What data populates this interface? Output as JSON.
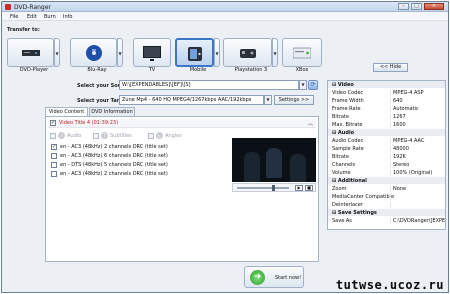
{
  "window": {
    "title": "DVD-Ranger"
  },
  "menu": [
    "File",
    "Edit",
    "Burn",
    "Info"
  ],
  "transfer_label": "Transfer to:",
  "targets": [
    {
      "label": "DVD-Player",
      "icon": "dvd-player-icon",
      "selected": false
    },
    {
      "label": "Blu-Ray",
      "icon": "bluray-disc-icon",
      "selected": false
    },
    {
      "label": "TV",
      "icon": "tv-icon",
      "selected": false
    },
    {
      "label": "Mobile",
      "icon": "mobile-phone-icon",
      "selected": true
    },
    {
      "label": "Playstation 3",
      "icon": "playstation-icon",
      "selected": false
    },
    {
      "label": "XBox",
      "icon": "xbox-icon",
      "selected": false
    }
  ],
  "hide_button": "<< Hide",
  "source": {
    "label": "Select your Source:",
    "value": "W:\\[EXPENDABLES]\\[EF]\\[S]"
  },
  "target": {
    "label": "Select your Target:",
    "value": "Zune Mp4 - 640 HQ MPEG4/1267kbps AAC/192kbps"
  },
  "settings_button": "Settings >>",
  "tabs": [
    "Video Content",
    "DVD Information"
  ],
  "video_title": "Video Title 4 (01:39:23)",
  "subheaders": [
    "Audio",
    "Subtitles",
    "Angles"
  ],
  "audio_tracks": [
    {
      "text": "en - AC3 (48kHz) 2 channels DRC (title set)",
      "checked": true
    },
    {
      "text": "en - AC3 (48kHz) 6 channels DRC (title set)",
      "checked": false
    },
    {
      "text": "en - DTS (48kHz) 5 channels DRC (title set)",
      "checked": false
    },
    {
      "text": "en - AC3 (48kHz) 2 channels DRC (title set)",
      "checked": false
    }
  ],
  "playback_position": 0.7,
  "properties": [
    {
      "type": "category",
      "name": "Video"
    },
    {
      "type": "row",
      "key": "Video Codec",
      "value": "MPEG-4 ASP"
    },
    {
      "type": "row",
      "key": "Frame Width",
      "value": "640"
    },
    {
      "type": "row",
      "key": "Frame Rate",
      "value": "Automatic"
    },
    {
      "type": "row",
      "key": "Bitrate",
      "value": "1267"
    },
    {
      "type": "row",
      "key": "Max. Bitrate",
      "value": "1600"
    },
    {
      "type": "category",
      "name": "Audio"
    },
    {
      "type": "row",
      "key": "Audio Codec",
      "value": "MPEG-4 AAC"
    },
    {
      "type": "row",
      "key": "Sample Rate",
      "value": "48000"
    },
    {
      "type": "row",
      "key": "Bitrate",
      "value": "192K"
    },
    {
      "type": "row",
      "key": "Channels",
      "value": "Stereo"
    },
    {
      "type": "row",
      "key": "Volume",
      "value": "100% (Original)"
    },
    {
      "type": "category",
      "name": "Additional"
    },
    {
      "type": "row",
      "key": "Zoom",
      "value": "None"
    },
    {
      "type": "row",
      "key": "MediaCenter Compatible",
      "value": ""
    },
    {
      "type": "row",
      "key": "Deinterlacer",
      "value": ""
    },
    {
      "type": "category",
      "name": "Save Settings"
    },
    {
      "type": "row",
      "key": "Save As",
      "value": "C:\\DVDRanger\\[EXPEN"
    }
  ],
  "start_button": "Start now!",
  "watermark": "tutwse.ucoz.ru",
  "colors": {
    "accent": "#3b76c7",
    "title_red": "#c22020",
    "start_green": "#2e9b2a"
  }
}
